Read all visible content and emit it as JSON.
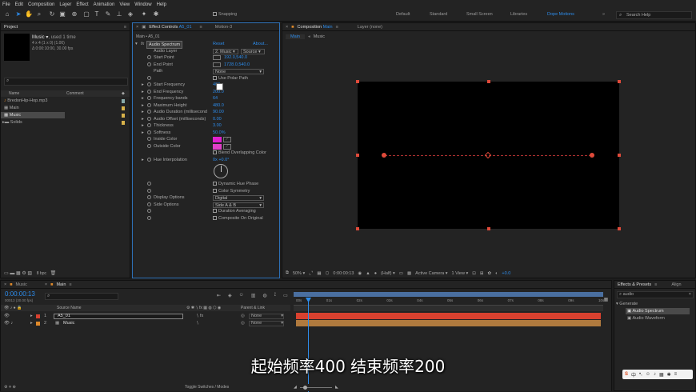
{
  "menu": [
    "File",
    "Edit",
    "Composition",
    "Layer",
    "Effect",
    "Animation",
    "View",
    "Window",
    "Help"
  ],
  "toolbar": {
    "snapping": "Snapping",
    "workspaces": [
      "Default",
      "Standard",
      "Small Screen",
      "Libraries",
      "Dope Motions"
    ],
    "search": "Search Help"
  },
  "project": {
    "tab": "Project",
    "item_name": "Music",
    "used": ", used 1 time",
    "info1": "4 x 4  (1 x 0) (1.00)",
    "info2": "Δ 0:00:10:00, 30.00 fps",
    "col_name": "Name",
    "col_comment": "Comment",
    "items": [
      "BredonHip-Hop.mp3",
      "Main",
      "Music",
      "Solids"
    ],
    "bpc": "8 bpc"
  },
  "effects": {
    "tab": "Effect Controls",
    "tab_item": "A5_01",
    "tab2": "Motion-3",
    "breadcrumb": "Main • A5_01",
    "fx_name": "Audio Spectrum",
    "reset": "Reset",
    "about": "About...",
    "params": [
      {
        "label": "Audio Layer",
        "value": "2. Music",
        "value2": "Source"
      },
      {
        "label": "Start Point",
        "value": "192.0,540.0"
      },
      {
        "label": "End Point",
        "value": "1728.0,540.0"
      },
      {
        "label": "Path",
        "value": "None"
      },
      {
        "label": "",
        "value": "Use Polar Path"
      },
      {
        "label": "Start Frequency",
        "value": "400"
      },
      {
        "label": "End Frequency",
        "value": "200.0"
      },
      {
        "label": "Frequency bands",
        "value": "64"
      },
      {
        "label": "Maximum Height",
        "value": "480.0"
      },
      {
        "label": "Audio Duration (millisecond",
        "value": "90.00"
      },
      {
        "label": "Audio Offset (milliseconds)",
        "value": "0.00"
      },
      {
        "label": "Thickness",
        "value": "3.00"
      },
      {
        "label": "Softness",
        "value": "50.0%"
      },
      {
        "label": "Inside Color",
        "value": ""
      },
      {
        "label": "Outside Color",
        "value": ""
      },
      {
        "label": "",
        "value": "Blend Overlapping Color"
      },
      {
        "label": "Hue Interpolation",
        "value": "0x +0.0°"
      },
      {
        "label": "",
        "value": "Dynamic Hue Phase"
      },
      {
        "label": "",
        "value": "Color Symmetry"
      },
      {
        "label": "Display Options",
        "value": "Digital"
      },
      {
        "label": "Side Options",
        "value": "Side A & B"
      },
      {
        "label": "",
        "value": "Duration Averaging"
      },
      {
        "label": "",
        "value": "Composite On Original"
      }
    ]
  },
  "comp": {
    "tab": "Composition",
    "tab_item": "Main",
    "layer": "Layer (none)",
    "crumb1": "Main",
    "crumb2": "Music",
    "zoom": "50%",
    "time": "0:00:00:13",
    "quality": "(Half)",
    "camera": "Active Camera",
    "views": "1 View",
    "exposure": "+0.0"
  },
  "timeline": {
    "tabs": [
      "Music",
      "Main"
    ],
    "time": "0:00:00:13",
    "fps": "00013 (30.00 fps)",
    "col_source": "Source Name",
    "col_parent": "Parent & Link",
    "layers": [
      {
        "num": "1",
        "name": "A5_01",
        "parent": "None"
      },
      {
        "num": "2",
        "name": "Music",
        "parent": "None"
      }
    ],
    "ticks": [
      "00s",
      "01s",
      "02s",
      "03s",
      "04s",
      "05s",
      "06s",
      "07s",
      "08s",
      "09s",
      "10s"
    ],
    "toggle": "Toggle Switches / Modes"
  },
  "fxpresets": {
    "tab": "Effects & Presets",
    "tab2": "Align",
    "search": "audio",
    "group": "Generate",
    "items": [
      "Audio Spectrum",
      "Audio Waveform"
    ]
  },
  "subtitle": "起始频率400 结束频率200",
  "colors": {
    "accent": "#2d8ceb",
    "inside": "#e020d0",
    "outside": "#e040c8",
    "bar1": "#d9412f",
    "bar2": "#b07a3e"
  }
}
